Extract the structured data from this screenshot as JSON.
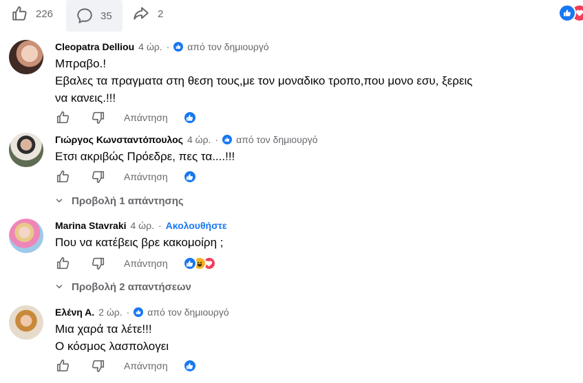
{
  "post_actions": {
    "like_count": "226",
    "comment_count": "35",
    "share_count": "2"
  },
  "colors": {
    "accent": "#1877f2",
    "muted": "#65676b",
    "love": "#f33e58",
    "haha": "#f7b125"
  },
  "comments": [
    {
      "author": "Cleopatra Delliou",
      "time": "4 ώρ.",
      "dot": "·",
      "badge": "από τον δημιουργό",
      "lines": [
        "Μπραβο.!",
        "Εβαλες τα πραγματα στη θεση τους,με τον μοναδικο τροπο,που μονο εσυ, ξερεις",
        "να κανεις.!!!"
      ],
      "reply_label": "Απάντηση",
      "reactions": [
        "like-icon"
      ]
    },
    {
      "author": "Γιώργος Κωνσταντόπουλος",
      "time": "4 ώρ.",
      "dot": "·",
      "badge": "από τον δημιουργό",
      "lines": [
        "Ετσι ακριβώς Πρόεδρε, πες τα....!!!"
      ],
      "reply_label": "Απάντηση",
      "reactions": [
        "like-icon"
      ],
      "view_replies": "Προβολή 1 απάντησης"
    },
    {
      "author": "Marina Stavraki",
      "time": "4 ώρ.",
      "dot": "·",
      "follow": "Ακολουθήστε",
      "lines": [
        "Που να κατέβεις βρε κακομοίρη ;"
      ],
      "reply_label": "Απάντηση",
      "reactions": [
        "like-icon",
        "haha-icon",
        "love-icon"
      ],
      "view_replies": "Προβολή 2 απαντήσεων"
    },
    {
      "author": "Ελένη Α.",
      "time": "2 ώρ.",
      "dot": "·",
      "badge": "από τον δημιουργό",
      "lines": [
        "Μια χαρά τα λέτε!!!",
        "Ο κόσμος λασπολογει"
      ],
      "reply_label": "Απάντηση",
      "reactions": [
        "like-icon"
      ]
    }
  ]
}
